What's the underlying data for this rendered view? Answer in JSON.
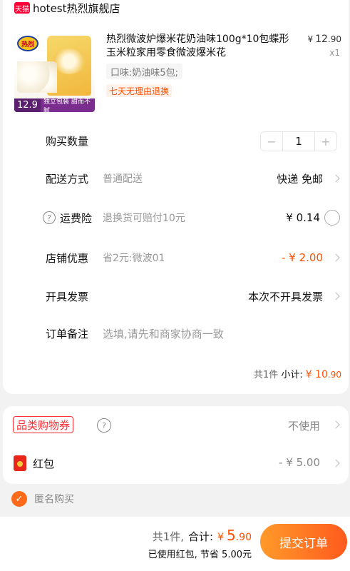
{
  "shop": {
    "badge": "天猫",
    "name": "hotest热烈旗舰店"
  },
  "product": {
    "title": "热烈微波炉爆米花奶油味100g*10包蝶形玉米粒家用零食微波爆米花",
    "price_currency": "¥",
    "price_int": "12",
    "price_dec": ".90",
    "quantity_label": "x1",
    "sku": "口味:奶油味5包;",
    "return_policy": "七天无理由退换",
    "image": {
      "logo_text": "热烈",
      "price_big": "12.9",
      "price_rest": "独立包装 甜而不腻"
    }
  },
  "rows": {
    "quantity": {
      "label": "购买数量",
      "minus": "−",
      "value": "1",
      "plus": "+"
    },
    "delivery": {
      "label": "配送方式",
      "sub": "普通配送",
      "value": "快递 免邮"
    },
    "insurance": {
      "label": "运费险",
      "help": "?",
      "sub": "退换货可赔付10元",
      "value": "¥ 0.14"
    },
    "shop_discount": {
      "label": "店铺优惠",
      "sub": "省2元:微波01",
      "value": "- ¥ 2.00"
    },
    "invoice": {
      "label": "开具发票",
      "value": "本次不开具发票"
    },
    "remark": {
      "label": "订单备注",
      "placeholder": "选填,请先和商家协商一致"
    }
  },
  "subtotal": {
    "count": "共1件",
    "label": "小计:",
    "currency": "¥",
    "int": "10",
    "dec": ".90"
  },
  "bonus": {
    "coupon": {
      "label": "品类购物券",
      "help": "?",
      "value": "不使用"
    },
    "red_packet": {
      "label": "红包",
      "value": "- ¥ 5.00"
    }
  },
  "anonymous": {
    "label": "匿名购买",
    "checked": true
  },
  "footer": {
    "count": "共1件,",
    "total_label": "合计:",
    "currency": "¥",
    "total_int": "5",
    "total_dec": ".90",
    "saved": "已使用红包, 节省 5.00元",
    "submit": "提交订单"
  },
  "colors": {
    "accent": "#ff5000",
    "tmall": "#ff0036",
    "submit_start": "#ff9a2a",
    "submit_end": "#ff5a1d"
  }
}
